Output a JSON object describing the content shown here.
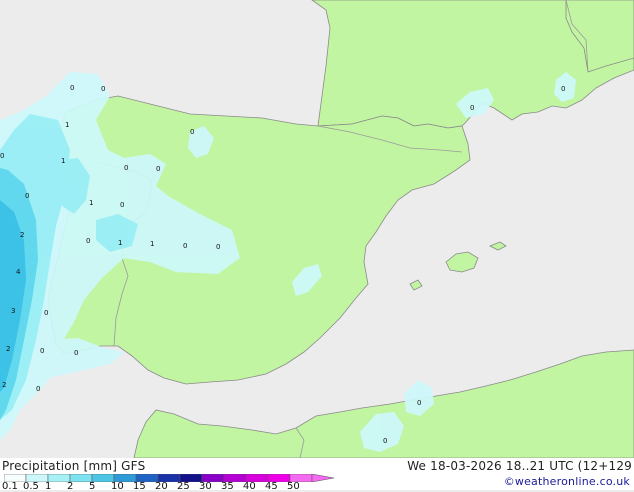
{
  "colors": {
    "sea": "#ececec",
    "land": "#c2f5a2",
    "coast": "#8a8a8a",
    "border": "#9a9a9a",
    "precip_light": "#cdf8fb",
    "precip_mid": "#9aeef6",
    "precip_strong": "#62d8ee",
    "precip_heavy": "#3cc2e6"
  },
  "map_labels": [
    "0",
    "0",
    "1",
    "1",
    "0",
    "0",
    "1",
    "0",
    "0",
    "0",
    "1",
    "1",
    "0",
    "0",
    "0",
    "0",
    "2",
    "4",
    "3",
    "2",
    "2",
    "0",
    "0",
    "0",
    "0",
    "0",
    "0",
    "0",
    "0"
  ],
  "footer": {
    "title": "Precipitation [mm]  GFS",
    "datetime": "We 18-03-2026 18..21 UTC (12+129",
    "credit": "©weatheronline.co.uk"
  },
  "legend": {
    "labels": [
      "0.1",
      "0.5",
      "1",
      "2",
      "5",
      "10",
      "15",
      "20",
      "25",
      "30",
      "35",
      "40",
      "45",
      "50"
    ],
    "colors": [
      "#f5fdfd",
      "#cdf8fb",
      "#a6f0f6",
      "#7fe2f0",
      "#4fc5e6",
      "#2e9ad8",
      "#1e63c4",
      "#1a32a8",
      "#14128a",
      "#8a00c8",
      "#b400d4",
      "#d800dc",
      "#f000e8",
      "#f46af0"
    ]
  }
}
